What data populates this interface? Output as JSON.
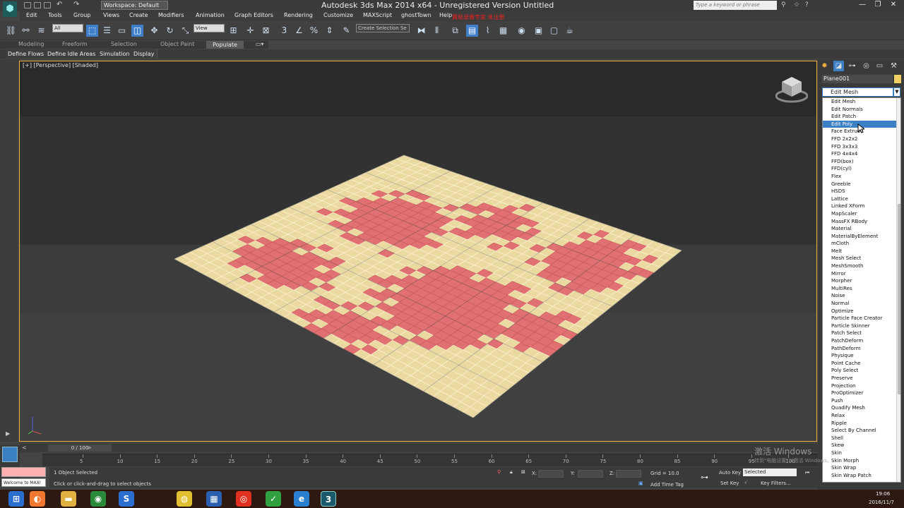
{
  "window": {
    "title": "Autodesk 3ds Max  2014 x64 - Unregistered Version   Untitled",
    "workspace": "Workspace: Default",
    "search_placeholder": "Type a keyword or phrase",
    "controls": [
      "—",
      "❐",
      "✕"
    ]
  },
  "menu": {
    "items": [
      "Edit",
      "Tools",
      "Group",
      "Views",
      "Create",
      "Modifiers",
      "Animation",
      "Graph Editors",
      "Rendering",
      "Customize",
      "MAXScript",
      "ghostTown",
      "Help"
    ],
    "overlay_text": "翼极录像专家  未注册"
  },
  "toolbar": {
    "selection_filter": "All",
    "reference_coord": "View",
    "named_selection": "Create Selection Se"
  },
  "ribbon": {
    "tabs": [
      "Modeling",
      "Freeform",
      "Selection",
      "Object Paint",
      "Populate"
    ],
    "active_tab": "Populate",
    "sub_tabs": [
      "Define Flows",
      "Define Idle Areas",
      "Simulation",
      "Display"
    ]
  },
  "viewport": {
    "label": "[+] [Perspective] [Shaded]"
  },
  "command_panel": {
    "object_name": "Plane001",
    "modifier_list_value": "Edit Mesh",
    "highlighted_item": "Edit Poly",
    "modifiers": [
      "Edit Mesh",
      "Edit Normals",
      "Edit Patch",
      "Edit Poly",
      "Face Extrude",
      "FFD 2x2x2",
      "FFD 3x3x3",
      "FFD 4x4x4",
      "FFD(box)",
      "FFD(cyl)",
      "Flex",
      "Greeble",
      "HSDS",
      "Lattice",
      "Linked XForm",
      "MapScaler",
      "MassFX RBody",
      "Material",
      "MaterialByElement",
      "mCloth",
      "Melt",
      "Mesh Select",
      "MeshSmooth",
      "Mirror",
      "Morpher",
      "MultiRes",
      "Noise",
      "Normal",
      "Optimize",
      "Particle Face Creator",
      "Particle Skinner",
      "Patch Select",
      "PatchDeform",
      "PathDeform",
      "Physique",
      "Point Cache",
      "Poly Select",
      "Preserve",
      "Projection",
      "ProOptimizer",
      "Push",
      "Quadify Mesh",
      "Relax",
      "Ripple",
      "Select By Channel",
      "Shell",
      "Skew",
      "Skin",
      "Skin Morph",
      "Skin Wrap",
      "Skin Wrap Patch"
    ]
  },
  "timeline": {
    "frame_counter": "0 / 100",
    "ticks": [
      "5",
      "10",
      "15",
      "20",
      "25",
      "30",
      "35",
      "40",
      "45",
      "50",
      "55",
      "60",
      "65",
      "70",
      "75",
      "80",
      "85",
      "90",
      "95",
      "100"
    ]
  },
  "status": {
    "maxscript": "Welcome to MAX!",
    "selection_info": "1 Object Selected",
    "prompt": "Click or click-and-drag to select objects",
    "x_label": "X:",
    "y_label": "Y:",
    "z_label": "Z:",
    "grid": "Grid = 10.0",
    "add_time_tag": "Add Time Tag",
    "auto_key": "Auto Key",
    "set_key": "Set Key",
    "key_mode": "Selected",
    "key_filters": "Key Filters..."
  },
  "windows_overlay": {
    "activate_title": "激活 Windows",
    "activate_sub": "转到\"电脑设置\"以激活 Windows。"
  },
  "taskbar": {
    "time": "19:06",
    "date": "2016/11/7"
  },
  "colors": {
    "viewport_border": "#f0b040",
    "checker_red": "#e07072",
    "checker_tan": "#ead9a0",
    "highlight_blue": "#3b7fc5"
  }
}
